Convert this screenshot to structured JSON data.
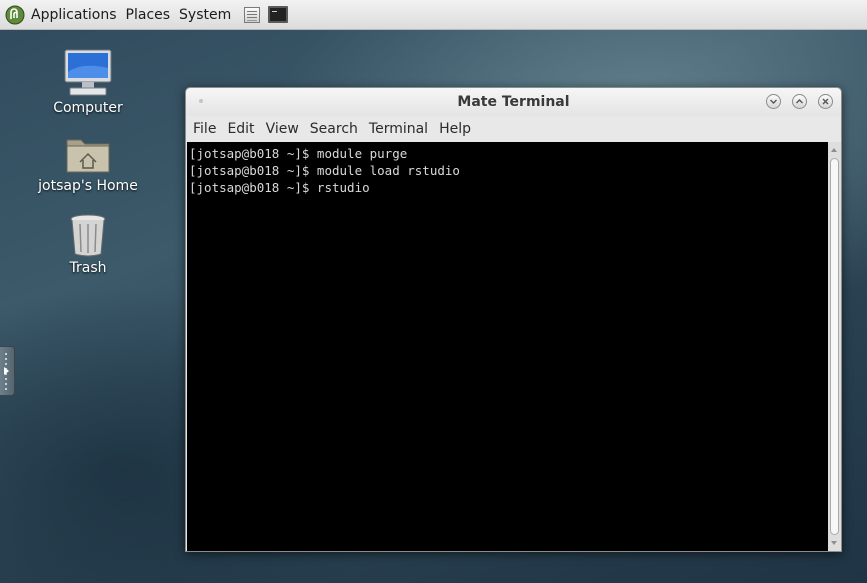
{
  "panel": {
    "menus": [
      "Applications",
      "Places",
      "System"
    ],
    "launchers": [
      {
        "icon": "notes-launcher-icon"
      },
      {
        "icon": "terminal-launcher-icon"
      }
    ]
  },
  "desktop": {
    "icons": [
      {
        "label": "Computer",
        "icon": "computer-icon"
      },
      {
        "label": "jotsap's Home",
        "icon": "home-folder-icon"
      },
      {
        "label": "Trash",
        "icon": "trash-icon"
      }
    ]
  },
  "window": {
    "title": "Mate Terminal",
    "menu": [
      "File",
      "Edit",
      "View",
      "Search",
      "Terminal",
      "Help"
    ],
    "lines": [
      "[jotsap@b018 ~]$ module purge",
      "[jotsap@b018 ~]$ module load rstudio",
      "[jotsap@b018 ~]$ rstudio"
    ]
  },
  "colors": {
    "terminal_bg": "#000000",
    "terminal_fg": "#d9d9d9",
    "panel_bg": "#e6e6e6"
  }
}
